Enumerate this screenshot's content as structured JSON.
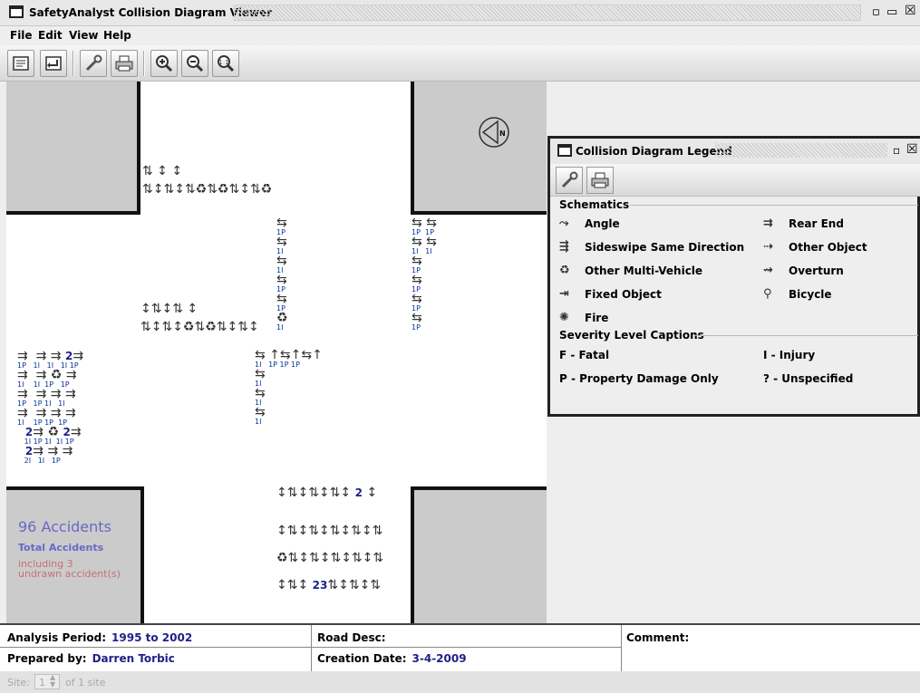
{
  "window": {
    "title": "SafetyAnalyst Collision Diagram Viewer"
  },
  "menu": [
    "File",
    "Edit",
    "View",
    "Help"
  ],
  "toolbar": {
    "buttons": [
      "report-icon",
      "return-icon",
      "wrench-icon",
      "print-icon",
      "zoom-in-icon",
      "zoom-out-icon",
      "zoom-reset-icon"
    ]
  },
  "diagram": {
    "accidents_count": "96 Accidents",
    "total_label": "Total Accidents",
    "undrawn_line1": "including 3",
    "undrawn_line2": "undrawn accident(s)",
    "north_label": "N",
    "group_numbers": [
      "2",
      "2",
      "2",
      "2",
      "2",
      "2",
      "3"
    ]
  },
  "legend": {
    "title": "Collision Diagram Legend",
    "schematics_title": "Schematics",
    "schematics": [
      {
        "icon": "angle-icon",
        "label": "Angle"
      },
      {
        "icon": "rear-end-icon",
        "label": "Rear End"
      },
      {
        "icon": "sideswipe-same-direction-icon",
        "label": "Sideswipe Same Direction"
      },
      {
        "icon": "other-object-icon",
        "label": "Other Object"
      },
      {
        "icon": "other-multi-vehicle-icon",
        "label": "Other Multi-Vehicle"
      },
      {
        "icon": "overturn-icon",
        "label": "Overturn"
      },
      {
        "icon": "fixed-object-icon",
        "label": "Fixed Object"
      },
      {
        "icon": "bicycle-icon",
        "label": "Bicycle"
      },
      {
        "icon": "fire-icon",
        "label": "Fire"
      }
    ],
    "severity_title": "Severity Level Captions",
    "severity": [
      "F - Fatal",
      "I - Injury",
      "P - Property Damage Only",
      "? - Unspecified"
    ]
  },
  "info": {
    "analysis_period_label": "Analysis Period:",
    "analysis_period_value": "1995 to 2002",
    "road_desc_label": "Road Desc:",
    "comment_label": "Comment:",
    "prepared_by_label": "Prepared by:",
    "prepared_by_value": "Darren Torbic",
    "creation_date_label": "Creation Date:",
    "creation_date_value": "3-4-2009"
  },
  "status": {
    "site_label": "Site:",
    "site_value": "1",
    "site_total": "of 1 site"
  }
}
